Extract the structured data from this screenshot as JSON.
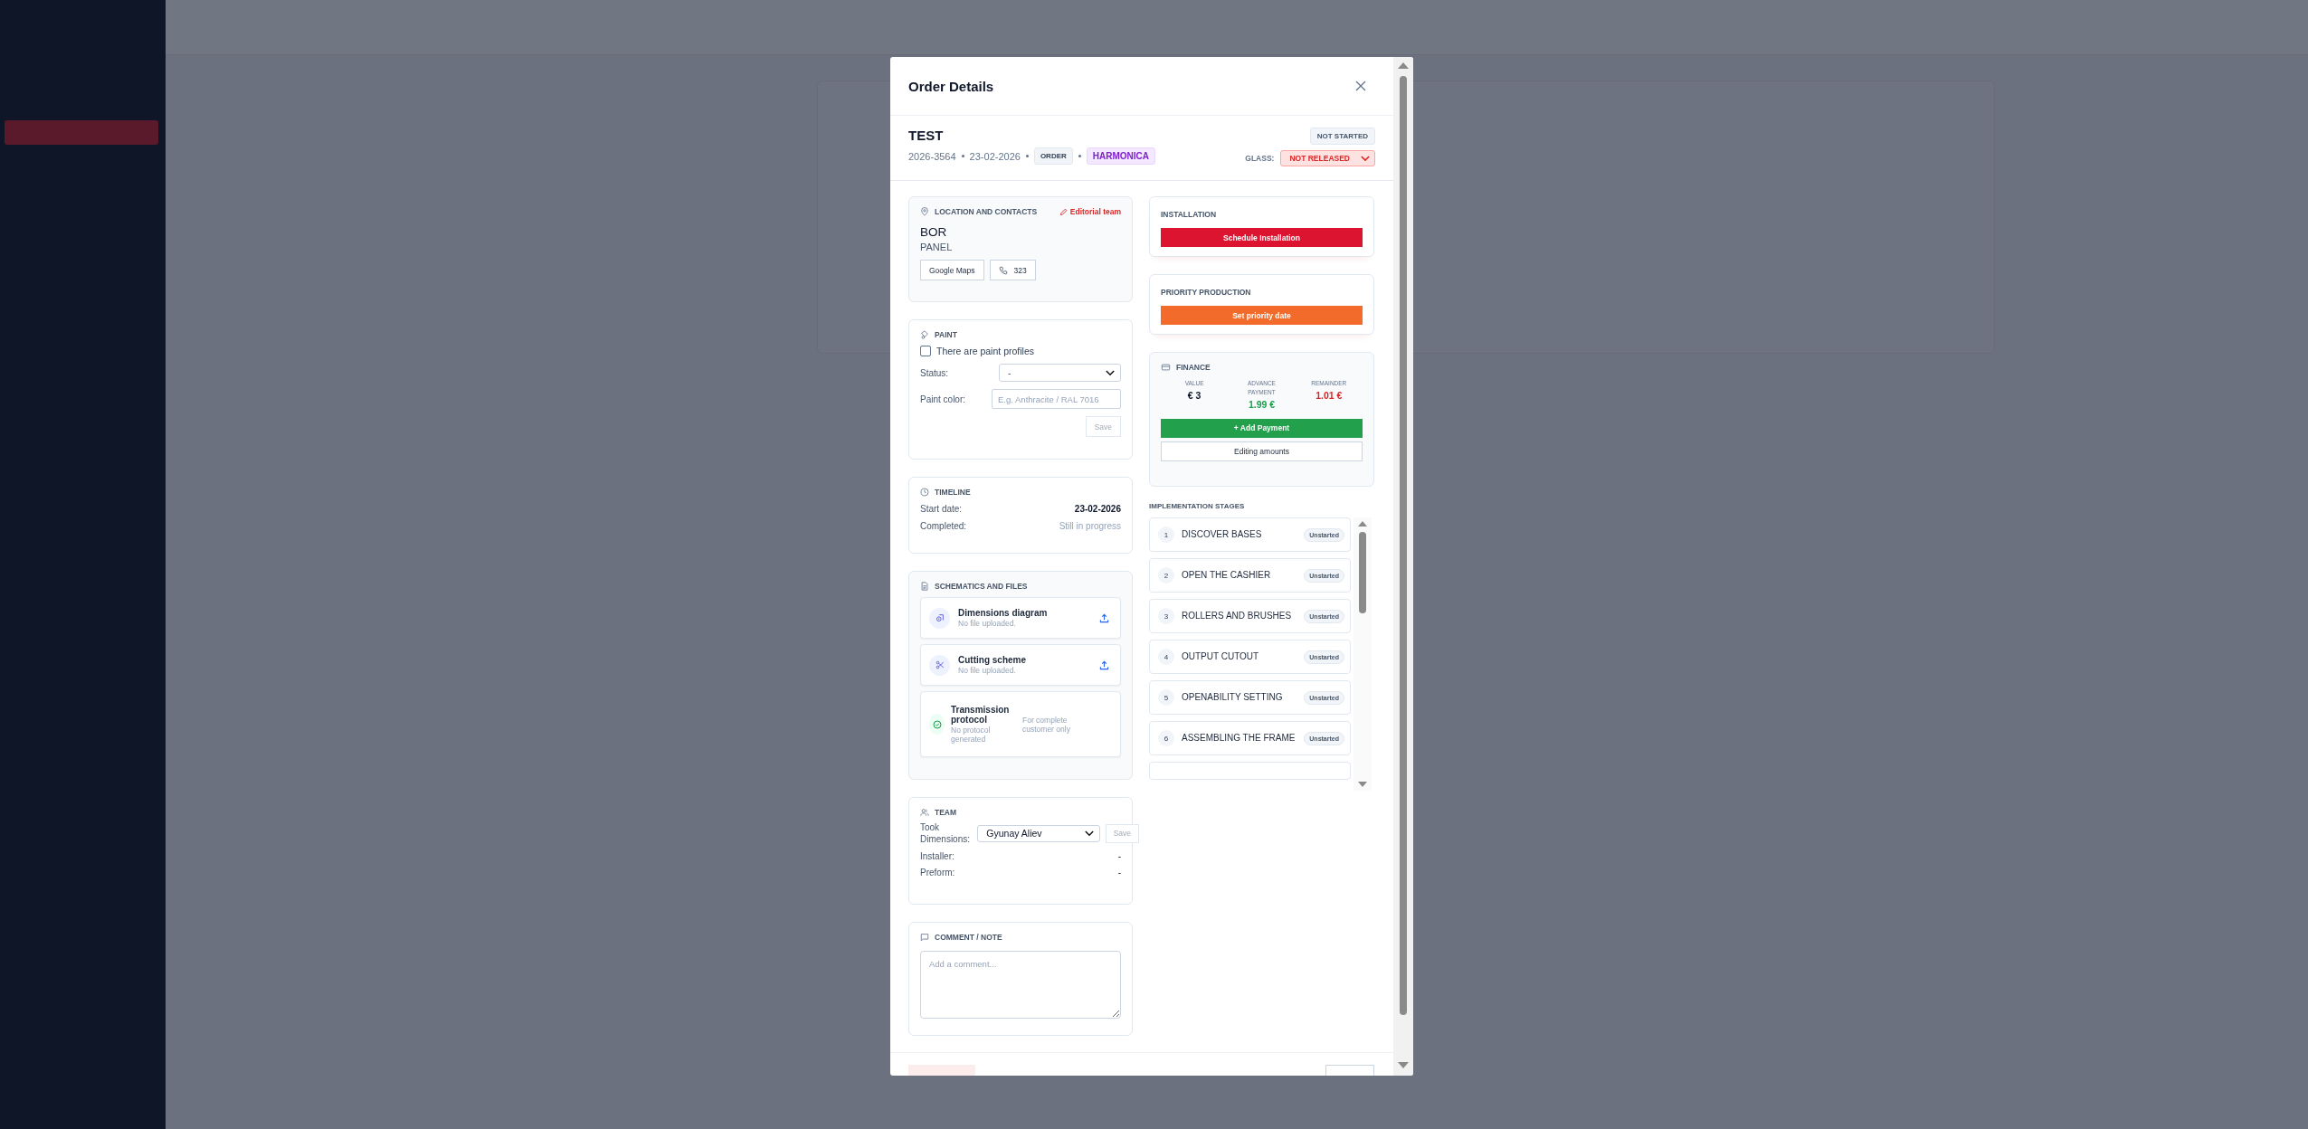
{
  "modal": {
    "title": "Order Details"
  },
  "order": {
    "name": "TEST",
    "number": "2026-3564",
    "date": "23-02-2026",
    "type": "ORDER",
    "product": "HARMONICA",
    "status": "NOT STARTED",
    "glass_label": "GLASS:",
    "glass_value": "NOT RELEASED"
  },
  "location": {
    "title": "LOCATION AND CONTACTS",
    "edit_link": "Editorial team",
    "name": "BOR",
    "subtitle": "PANEL",
    "buttons": [
      {
        "kind": "maps",
        "label": "Google Maps"
      },
      {
        "kind": "phone",
        "label": "323"
      }
    ]
  },
  "paint": {
    "title": "PAINT",
    "checkbox": {
      "label": "There are paint profiles",
      "checked": false
    },
    "status_label": "Status:",
    "status_value": "-",
    "color_label": "Paint color:",
    "color_placeholder": "E.g. Anthracite / RAL 7016",
    "save": {
      "label": "Save",
      "disabled": true
    }
  },
  "timeline": {
    "title": "TIMELINE",
    "rows": [
      {
        "kind": "strong",
        "label": "Start date:",
        "value": "23-02-2026"
      },
      {
        "kind": "muted",
        "label": "Completed:",
        "value": "Still in progress"
      }
    ]
  },
  "files": {
    "title": "SCHEMATICS AND FILES",
    "items": [
      {
        "kind": "upload",
        "name": "Dimensions diagram",
        "note": "No file uploaded."
      },
      {
        "kind": "upload",
        "name": "Cutting scheme",
        "note": "No file uploaded."
      },
      {
        "kind": "protocol",
        "name": "Transmission protocol",
        "note": "No protocol generated",
        "hint": "For complete customer only"
      }
    ]
  },
  "team": {
    "title": "TEAM",
    "rows": [
      {
        "kind": "select",
        "label": "Took Dimensions:",
        "value": "Gyunay Aliev",
        "save": {
          "label": "Save",
          "disabled": true
        }
      },
      {
        "kind": "text",
        "label": "Installer:",
        "value": "-"
      },
      {
        "kind": "text",
        "label": "Preform:",
        "value": "-"
      }
    ]
  },
  "comment": {
    "title": "COMMENT / NOTE",
    "placeholder": "Add a comment..."
  },
  "installation": {
    "title": "INSTALLATION",
    "button": "Schedule Installation"
  },
  "priority": {
    "title": "PRIORITY PRODUCTION",
    "button": "Set priority date"
  },
  "finance": {
    "title": "FINANCE",
    "values": [
      {
        "kind": "neutral",
        "label": "VALUE",
        "amount": "€ 3"
      },
      {
        "kind": "positive",
        "label": "ADVANCE PAYMENT",
        "amount": "1.99 €"
      },
      {
        "kind": "negative",
        "label": "REMAINDER",
        "amount": "1.01 €"
      }
    ],
    "add_button": "+ Add Payment",
    "edit_button": "Editing amounts"
  },
  "stages": {
    "title": "IMPLEMENTATION STAGES",
    "items": [
      {
        "number": "1",
        "name": "DISCOVER BASES",
        "status": "Unstarted"
      },
      {
        "number": "2",
        "name": "OPEN THE CASHIER",
        "status": "Unstarted"
      },
      {
        "number": "3",
        "name": "ROLLERS AND BRUSHES",
        "status": "Unstarted"
      },
      {
        "number": "4",
        "name": "OUTPUT CUTOUT",
        "status": "Unstarted"
      },
      {
        "number": "5",
        "name": "OPENABILITY SETTING",
        "status": "Unstarted"
      },
      {
        "number": "6",
        "name": "ASSEMBLING THE FRAME",
        "status": "Unstarted"
      }
    ]
  }
}
